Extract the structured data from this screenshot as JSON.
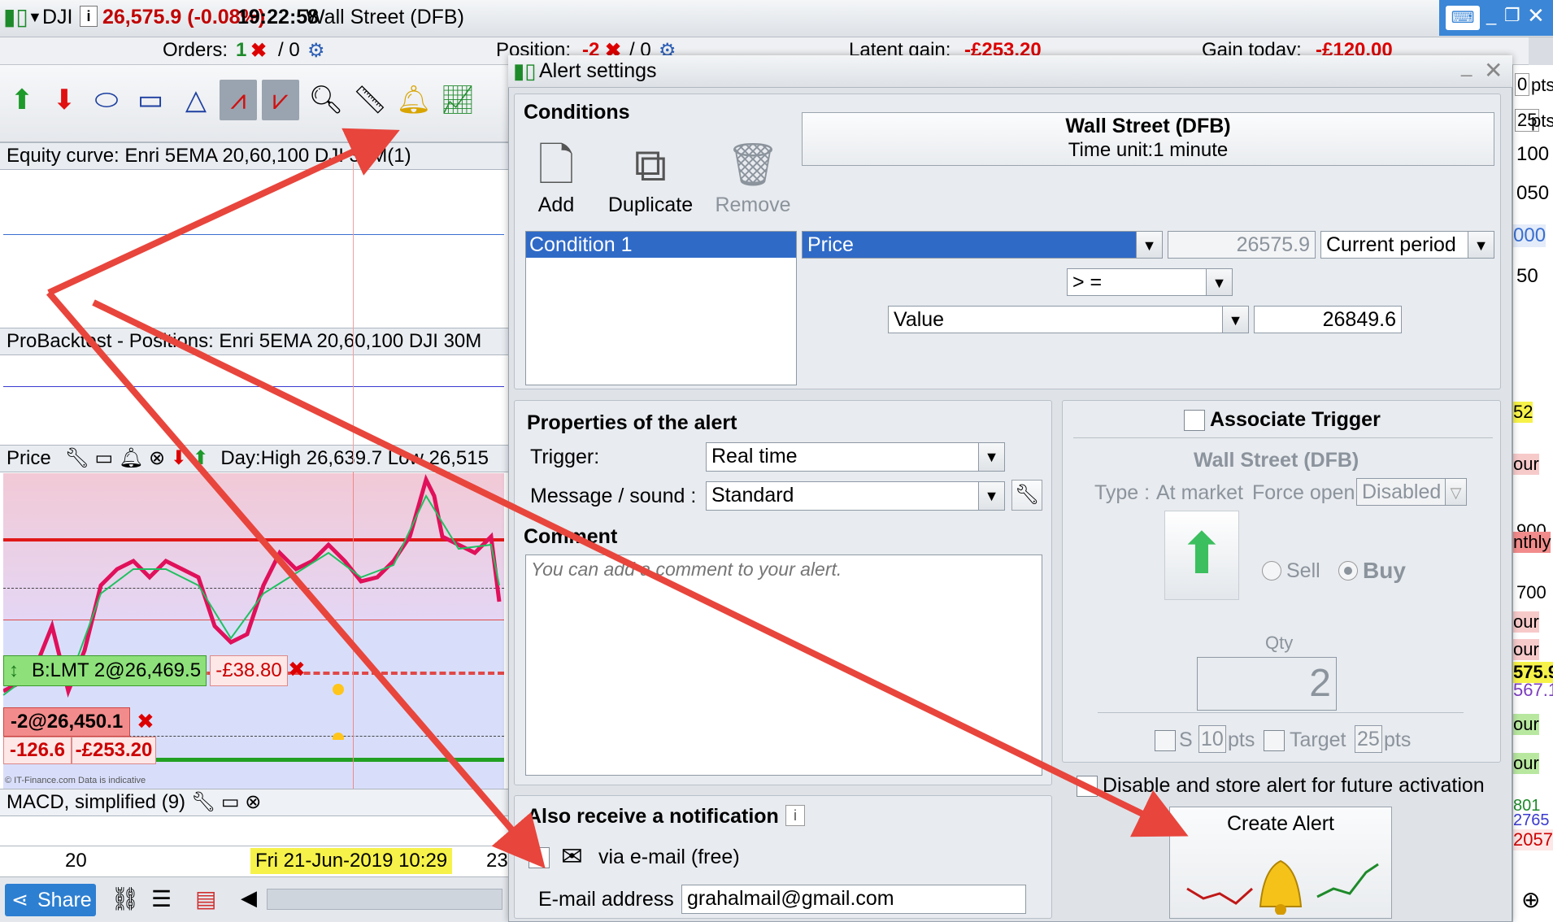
{
  "topbar": {
    "symbol": "DJI",
    "price_change": "26,575.9 (-0.08%)",
    "time": "19:22:58",
    "instrument": "Wall Street (DFB)"
  },
  "orders_bar": {
    "orders_label": "Orders:",
    "orders_count": "1",
    "orders_pending": "/ 0",
    "position_label": "Position:",
    "position_value": "-2",
    "position_pending": "/ 0",
    "latent_label": "Latent gain:",
    "latent_value": "-£253.20",
    "today_label": "Gain today:",
    "today_value": "-£120.00"
  },
  "panels": {
    "equity": "Equity curve: Enri 5EMA 20,60,100 DJI 30M(1)",
    "probacktest": "ProBacktest - Positions: Enri 5EMA 20,60,100 DJI 30M",
    "price_label": "Price",
    "price_day": "Day:High 26,639.7 Low 26,515",
    "macd": "MACD, simplified (9)"
  },
  "orders": {
    "limit_order": "B:LMT 2@26,469.5",
    "limit_pl": "-£38.80",
    "position": "-2@26,450.1",
    "pts": "-126.6",
    "pl": "-£253.20",
    "copyright": "© IT-Finance.com Data is indicative"
  },
  "time_axis": {
    "left": "20",
    "current": "Fri 21-Jun-2019 10:29",
    "right": "23"
  },
  "bottom_bar": {
    "share": "Share"
  },
  "right_axis": [
    "0",
    "pts",
    "25",
    "pts",
    "100",
    "050",
    "000",
    "50",
    "52",
    "our",
    "900",
    "nthly",
    "700",
    "our",
    "our",
    "575.9",
    "567.1",
    "our",
    "our",
    "801",
    "2765",
    "2057"
  ],
  "dialog": {
    "title": "Alert settings",
    "conditions": {
      "title": "Conditions",
      "add": "Add",
      "duplicate": "Duplicate",
      "remove": "Remove",
      "list": [
        "Condition 1"
      ],
      "instrument": "Wall Street (DFB)",
      "time_unit": "Time unit:1 minute",
      "price_select": "Price",
      "current_value": "26575.9",
      "period_select": "Current period",
      "operator_select": "> =",
      "value_select": "Value",
      "value_input": "26849.6"
    },
    "properties": {
      "title": "Properties of the alert",
      "trigger_label": "Trigger:",
      "trigger_value": "Real time",
      "sound_label": "Message / sound :",
      "sound_value": "Standard",
      "comment_label": "Comment",
      "comment_placeholder": "You can add a comment to your alert."
    },
    "notification": {
      "title": "Also receive a notification",
      "email_option": "via e-mail (free)",
      "email_label": "E-mail address",
      "email_value": "grahalmail@gmail.com"
    },
    "trigger": {
      "title": "Associate Trigger",
      "instrument": "Wall Street (DFB)",
      "type_label": "Type :",
      "type_value": "At market",
      "force_open": "Force open",
      "force_open_value": "Disabled",
      "sell": "Sell",
      "buy": "Buy",
      "qty_label": "Qty",
      "qty_value": "2",
      "stop_label": "S",
      "stop_value": "10",
      "stop_unit": "pts",
      "target_label": "Target",
      "target_value": "25",
      "target_unit": "pts"
    },
    "disable_store": "Disable and store alert for future activation",
    "create_button": "Create Alert"
  },
  "colors": {
    "accent_blue": "#3a6fd0",
    "loss_red": "#cc0000",
    "arrow_red": "#e8453c",
    "profit_green": "#22a022",
    "selection_blue": "#2f6ac7"
  }
}
